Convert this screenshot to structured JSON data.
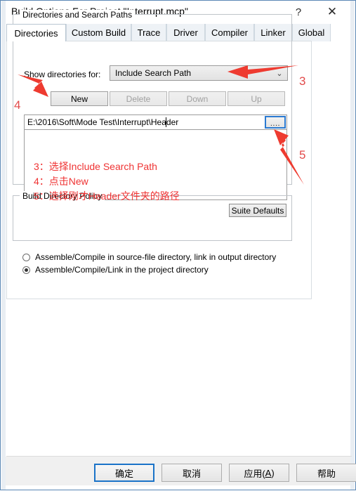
{
  "window": {
    "title": "Build Options For Project \"Interrupt.mcp\"",
    "help_button": "?",
    "close_button": "✕",
    "frame_color": "#5b87b5"
  },
  "tabs": [
    {
      "label": "Directories",
      "active": true
    },
    {
      "label": "Custom Build",
      "active": false
    },
    {
      "label": "Trace",
      "active": false
    },
    {
      "label": "Driver",
      "active": false
    },
    {
      "label": "Compiler",
      "active": false
    },
    {
      "label": "Linker",
      "active": false
    },
    {
      "label": "Global",
      "active": false
    }
  ],
  "directories_group": {
    "title": "Directories and Search Paths",
    "show_dirs_label": "Show directories for:",
    "combo_value": "Include Search Path",
    "chevron": "⌄",
    "buttons": {
      "new": "New",
      "delete": "Delete",
      "down": "Down",
      "up": "Up"
    },
    "path_value": "E:\\2016\\Soft\\Mode Test\\Interrupt\\Header",
    "browse_button": "....",
    "suite_defaults": "Suite Defaults"
  },
  "policy_group": {
    "title": "Build Directory Policy",
    "options": [
      {
        "label": "Assemble/Compile in source-file directory, link in output directory",
        "selected": false
      },
      {
        "label": "Assemble/Compile/Link in the project directory",
        "selected": true
      }
    ]
  },
  "annotations": {
    "color": "#ef3333",
    "step3_text": "3：选择Include Search Path",
    "step4_text": "4：点击New",
    "step5_text": "5：选择刚才Header文件夹的路径",
    "num3": "3",
    "num4": "4",
    "num5": "5"
  },
  "dialog_buttons": {
    "ok": "确定",
    "cancel": "取消",
    "apply_prefix": "应用(",
    "apply_accel": "A",
    "apply_suffix": ")",
    "help": "帮助"
  }
}
